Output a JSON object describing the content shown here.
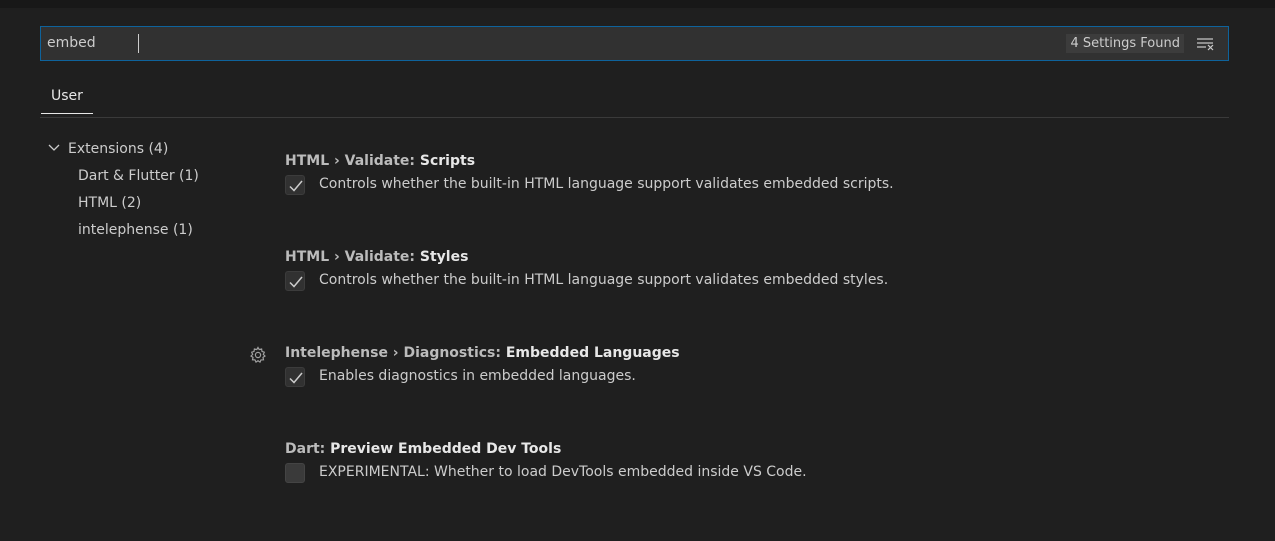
{
  "search": {
    "query": "embed",
    "result_count": "4 Settings Found",
    "clear_icon": "clear-filter-icon"
  },
  "tabs": [
    {
      "label": "User"
    }
  ],
  "toc": {
    "group": {
      "label": "Extensions (4)",
      "icon": "chevron-down-icon"
    },
    "items": [
      {
        "label": "Dart & Flutter (1)"
      },
      {
        "label": "HTML (2)"
      },
      {
        "label": "intelephense (1)"
      }
    ]
  },
  "settings": [
    {
      "category": "HTML › Validate: ",
      "key": "Scripts",
      "description": "Controls whether the built-in HTML language support validates embedded scripts.",
      "checked": true
    },
    {
      "category": "HTML › Validate: ",
      "key": "Styles",
      "description": "Controls whether the built-in HTML language support validates embedded styles.",
      "checked": true
    },
    {
      "category": "Intelephense › Diagnostics: ",
      "key": "Embedded Languages",
      "description": "Enables diagnostics in embedded languages.",
      "checked": true,
      "icon": "gear-icon"
    },
    {
      "category": "Dart: ",
      "key": "Preview Embedded Dev Tools",
      "description": "EXPERIMENTAL: Whether to load DevTools embedded inside VS Code.",
      "checked": false
    }
  ],
  "colors": {
    "background": "#1f1f1f",
    "focus_border": "#0e639c",
    "input_bg": "#313131"
  }
}
